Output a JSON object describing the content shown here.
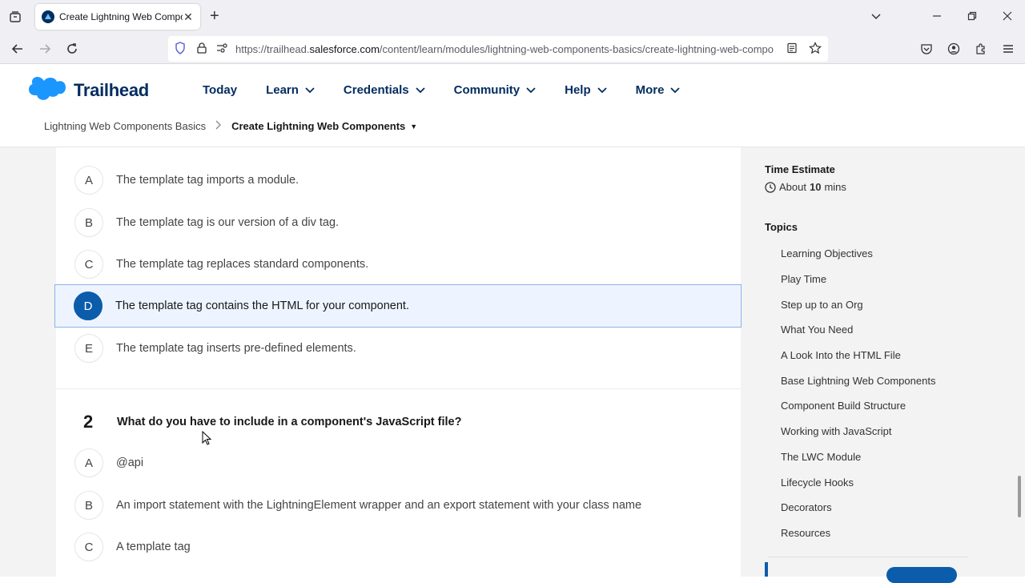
{
  "browser": {
    "tab_title": "Create Lightning Web Compon",
    "url_prefix": "https://trailhead.",
    "url_domain": "salesforce.com",
    "url_rest": "/content/learn/modules/lightning-web-components-basics/create-lightning-web-compo"
  },
  "site": {
    "brand": "Trailhead",
    "nav": [
      "Today",
      "Learn",
      "Credentials",
      "Community",
      "Help",
      "More"
    ],
    "breadcrumb": [
      "Lightning Web Components Basics",
      "Create Lightning Web Components"
    ]
  },
  "quiz": {
    "q1_answers": [
      {
        "letter": "A",
        "text": "The template tag imports a module."
      },
      {
        "letter": "B",
        "text": "The template tag is our version of a div tag."
      },
      {
        "letter": "C",
        "text": "The template tag replaces standard components."
      },
      {
        "letter": "D",
        "text": "The template tag contains the HTML for your component."
      },
      {
        "letter": "E",
        "text": "The template tag inserts pre-defined elements."
      }
    ],
    "q1_selected": "D",
    "q2": {
      "number": "2",
      "text": "What do you have to include in a component's JavaScript file?",
      "answers": [
        {
          "letter": "A",
          "text": "@api"
        },
        {
          "letter": "B",
          "text": "An import statement with the LightningElement wrapper and an export statement with your class name"
        },
        {
          "letter": "C",
          "text": "A template tag"
        }
      ]
    }
  },
  "sidebar": {
    "time_estimate_label": "Time Estimate",
    "time_prefix": "About",
    "time_value": "10",
    "time_unit": "mins",
    "topics_label": "Topics",
    "topics": [
      "Learning Objectives",
      "Play Time",
      "Step up to an Org",
      "What You Need",
      "A Look Into the HTML File",
      "Base Lightning Web Components",
      "Component Build Structure",
      "Working with JavaScript",
      "The LWC Module",
      "Lifecycle Hooks",
      "Decorators",
      "Resources"
    ]
  },
  "colors": {
    "brand_navy": "#032d60",
    "accent_blue": "#0b5cab",
    "selected_bg": "#eef4ff"
  }
}
